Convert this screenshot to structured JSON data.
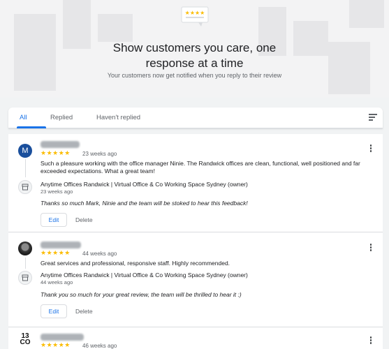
{
  "hero": {
    "title_line1": "Show customers you care, one",
    "title_line2": "response at a time",
    "subtitle": "Your customers now get notified when you reply to their review",
    "icon": "review-card-stars-icon"
  },
  "tabs": [
    {
      "label": "All",
      "active": true
    },
    {
      "label": "Replied",
      "active": false
    },
    {
      "label": "Haven't replied",
      "active": false
    }
  ],
  "sort_icon": "sort-icon",
  "reviews": [
    {
      "avatar_letter": "M",
      "stars": "★★★★★",
      "time": "23 weeks ago",
      "text": "Such a pleasure working with the office manager Ninie. The Randwick offices are clean, functional, well positioned and far exceeded expectations. What a great team!",
      "owner_name": "Anytime Offices Randwick | Virtual Office & Co Working Space Sydney (owner)",
      "owner_time": "23 weeks ago",
      "reply": "Thanks so much Mark, Ninie and the team will be stoked to hear this feedback!",
      "edit_label": "Edit",
      "delete_label": "Delete"
    },
    {
      "stars": "★★★★★",
      "time": "44 weeks ago",
      "text": "Great services and professional, responsive staff. Highly recommended.",
      "owner_name": "Anytime Offices Randwick | Virtual Office & Co Working Space Sydney (owner)",
      "owner_time": "44 weeks ago",
      "reply": "Thank you so much for your great review, the team will be thrilled to hear it :)",
      "edit_label": "Edit",
      "delete_label": "Delete"
    },
    {
      "avatar_text": "13 CO",
      "stars": "★★★★★",
      "time": "46 weeks ago"
    }
  ],
  "colors": {
    "accent": "#1a73e8",
    "star": "#fbbc04",
    "avatar_m": "#1a4f9c"
  }
}
